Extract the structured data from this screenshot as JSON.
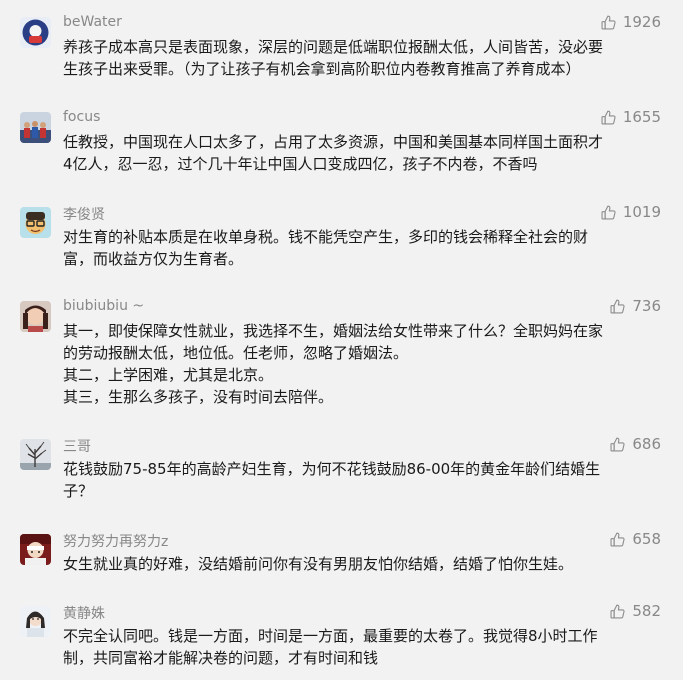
{
  "comments": [
    {
      "user": "beWater",
      "likes": "1926",
      "lines": [
        "养孩子成本高只是表面现象，深层的问题是低端职位报酬太低，人间皆苦，没必要",
        "生孩子出来受罪。（为了让孩子有机会拿到高阶职位内卷教育推高了养育成本）"
      ]
    },
    {
      "user": "focus",
      "likes": "1655",
      "lines": [
        "任教授，中国现在人口太多了，占用了太多资源，中国和美国基本同样国土面积才",
        "4亿人，忍一忍，过个几十年让中国人口变成四亿，孩子不内卷，不香吗"
      ]
    },
    {
      "user": "李俊贤",
      "likes": "1019",
      "lines": [
        "对生育的补贴本质是在收单身税。钱不能凭空产生，多印的钱会稀释全社会的财",
        "富，而收益方仅为生育者。"
      ]
    },
    {
      "user": "biubiubiu ~",
      "likes": "736",
      "lines": [
        "其一，即使保障女性就业，我选择不生，婚姻法给女性带来了什么？全职妈妈在家",
        "的劳动报酬太低，地位低。任老师，忽略了婚姻法。",
        "其二，上学困难，尤其是北京。",
        "其三，生那么多孩子，没有时间去陪伴。"
      ]
    },
    {
      "user": "三哥",
      "likes": "686",
      "lines": [
        "花钱鼓励75-85年的高龄产妇生育，为何不花钱鼓励86-00年的黄金年龄们结婚生",
        "子？"
      ]
    },
    {
      "user": "努力努力再努力z",
      "likes": "658",
      "lines": [
        "女生就业真的好难，没结婚前问你有没有男朋友怕你结婚，结婚了怕你生娃。"
      ]
    },
    {
      "user": "黄静姝",
      "likes": "582",
      "lines": [
        "不完全认同吧。钱是一方面，时间是一方面，最重要的太卷了。我觉得8小时工作",
        "制，共同富裕才能解决卷的问题，才有时间和钱"
      ]
    }
  ]
}
